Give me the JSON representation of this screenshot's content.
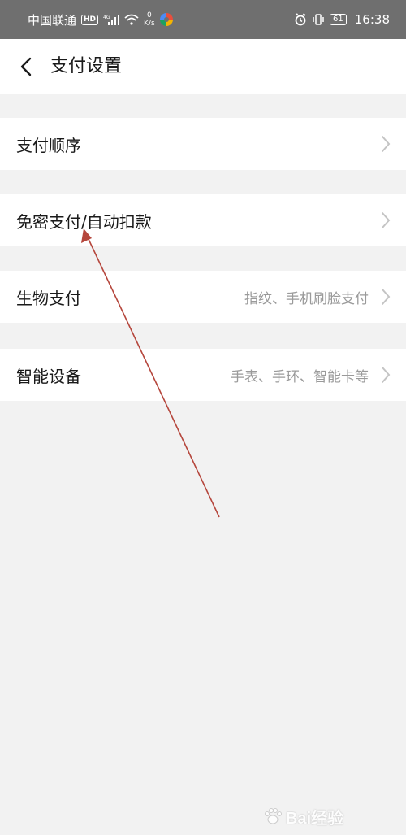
{
  "status_bar": {
    "carrier": "中国联通",
    "hd": "HD",
    "net_type": "4G",
    "speed_value": "0",
    "speed_unit": "K/s",
    "battery": "61",
    "time": "16:38"
  },
  "nav": {
    "back_icon": "chevron-left-icon",
    "title": "支付设置"
  },
  "settings": [
    {
      "label": "支付顺序",
      "value": ""
    },
    {
      "label": "免密支付/自动扣款",
      "value": ""
    },
    {
      "label": "生物支付",
      "value": "指纹、手机刷脸支付"
    },
    {
      "label": "智能设备",
      "value": "手表、手环、智能卡等"
    }
  ],
  "annotation": {
    "type": "arrow",
    "color": "#b5463c"
  },
  "watermark": {
    "text": "Bai经验"
  },
  "colors": {
    "status_bar": "#6f6f6f",
    "page_bg": "#f2f2f2",
    "row_bg": "#ffffff",
    "secondary_text": "#9a9a9a"
  }
}
